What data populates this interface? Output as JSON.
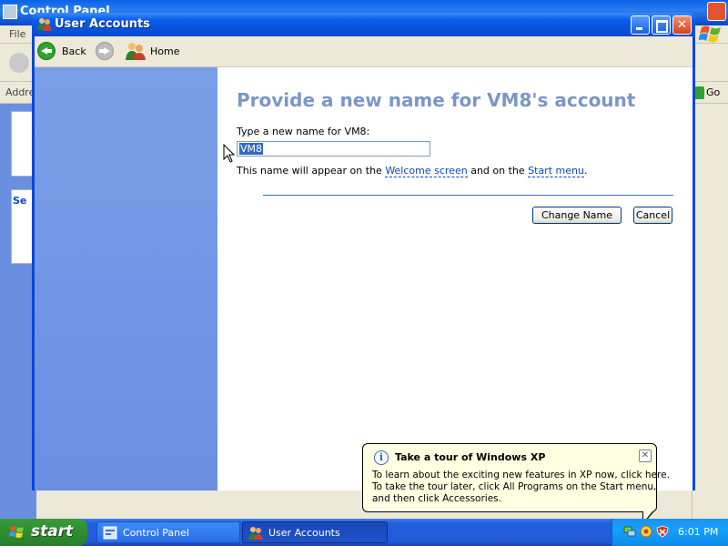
{
  "background_window": {
    "title": "Control Panel",
    "menu_file": "File",
    "address_label": "Address",
    "go_label": "Go",
    "side_section_label": "Se"
  },
  "window": {
    "title": "User Accounts"
  },
  "nav": {
    "back_label": "Back",
    "home_label": "Home"
  },
  "content": {
    "heading": "Provide a new name for VM8's account",
    "field_label": "Type a new name for VM8:",
    "input_value": "VM8",
    "hint_prefix": "This name will appear on the ",
    "hint_link_welcome": "Welcome screen",
    "hint_middle": " and on the ",
    "hint_link_start": "Start menu",
    "hint_suffix": ".",
    "change_name_label": "Change Name",
    "cancel_label": "Cancel"
  },
  "balloon": {
    "title": "Take a tour of Windows XP",
    "line1": "To learn about the exciting new features in XP now, click here.",
    "line2": "To take the tour later, click All Programs on the Start menu,",
    "line3": "and then click Accessories."
  },
  "taskbar": {
    "start_label": "start",
    "tasks": [
      {
        "label": "Control Panel"
      },
      {
        "label": "User Accounts"
      }
    ],
    "clock": "6:01 PM"
  },
  "colors": {
    "heading": "#7a96c8",
    "link": "#0846c8",
    "titlebar": "#0a5ee8",
    "left_panel": "#7b9ee8"
  },
  "icons": [
    "control-panel-icon",
    "user-accounts-icon",
    "back-arrow-icon",
    "forward-arrow-icon",
    "home-icon",
    "info-icon",
    "close-icon",
    "windows-flag-icon",
    "network-icon",
    "security-shield-icon"
  ]
}
